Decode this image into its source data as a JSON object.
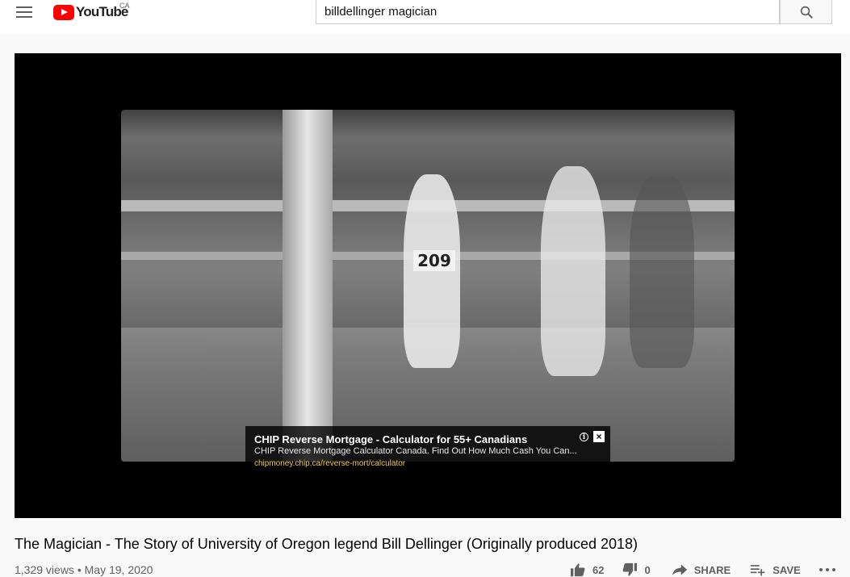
{
  "header": {
    "logo_text": "YouTube",
    "country_code": "CA",
    "search_value": "billdellinger magician",
    "icons": {
      "menu": "hamburger-menu-icon",
      "search": "search-icon"
    }
  },
  "player": {
    "bib_number": "209",
    "ad": {
      "title": "CHIP Reverse Mortgage - Calculator for 55+ Canadians",
      "description": "CHIP Reverse Mortgage Calculator Canada. Find Out How Much Cash You Can...",
      "url": "chipmoney.chip.ca/reverse-mort/calculator",
      "info_icon": "info-icon",
      "close_icon": "close-icon"
    }
  },
  "video": {
    "title": "The Magician - The Story of University of Oregon legend Bill Dellinger (Originally produced 2018)",
    "views": "1,329 views",
    "date": "May 19, 2020",
    "separator": " • "
  },
  "actions": {
    "like_count": "62",
    "dislike_count": "0",
    "share_label": "SHARE",
    "save_label": "SAVE"
  },
  "colors": {
    "brand_red": "#ff0000",
    "ad_url": "#f2c94c",
    "text_secondary": "#606060"
  }
}
